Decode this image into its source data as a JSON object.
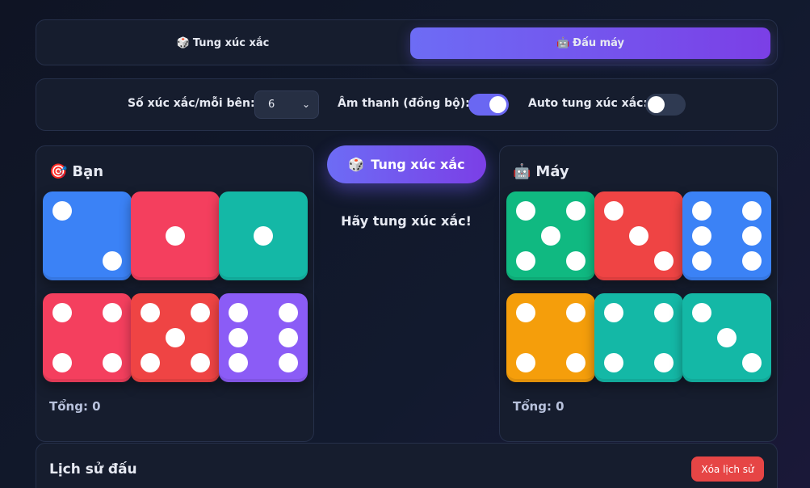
{
  "tabs": [
    {
      "icon": "🎲",
      "label": "Tung xúc xắc"
    },
    {
      "icon": "🤖",
      "label": "Đấu máy"
    }
  ],
  "settings": {
    "dice_label": "Số xúc xắc/mỗi bên:",
    "dice_value": "6",
    "sound_label": "Âm thanh (đồng bộ):",
    "sound_on": true,
    "auto_label": "Auto tung xúc xắc:",
    "auto_on": false
  },
  "player": {
    "icon": "🎯",
    "title": "Bạn",
    "total": "Tổng: 0",
    "dice": [
      {
        "value": 2,
        "color": "#3b82f6"
      },
      {
        "value": 1,
        "color": "#f43f5e"
      },
      {
        "value": 1,
        "color": "#14b8a6"
      },
      {
        "value": 4,
        "color": "#f43f5e"
      },
      {
        "value": 5,
        "color": "#ef4444"
      },
      {
        "value": 6,
        "color": "#8b5cf6"
      }
    ]
  },
  "cpu": {
    "icon": "🤖",
    "title": "Máy",
    "total": "Tổng: 0",
    "dice": [
      {
        "value": 5,
        "color": "#10b981"
      },
      {
        "value": 3,
        "color": "#ef4444"
      },
      {
        "value": 6,
        "color": "#3b82f6"
      },
      {
        "value": 4,
        "color": "#f59e0b"
      },
      {
        "value": 4,
        "color": "#14b8a6"
      },
      {
        "value": 3,
        "color": "#14b8a6"
      }
    ]
  },
  "roll_button": {
    "icon": "🎲",
    "label": "Tung xúc xắc"
  },
  "status": "Hãy tung xúc xắc!",
  "history": {
    "title": "Lịch sử đấu",
    "clear_label": "Xóa lịch sử"
  }
}
